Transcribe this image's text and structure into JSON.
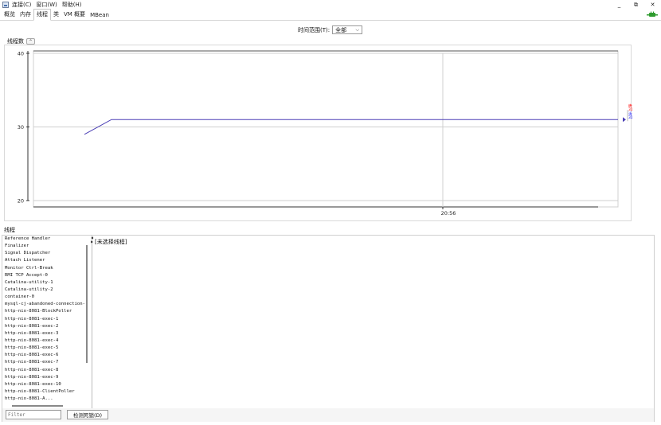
{
  "menu": {
    "items": [
      "连接(C)",
      "窗口(W)",
      "帮助(H)"
    ]
  },
  "window_controls": {
    "minimize": "_",
    "restore": "⧉",
    "close": "✕"
  },
  "tabs": [
    "概览",
    "内存",
    "线程",
    "类",
    "VM 概要",
    "MBean"
  ],
  "active_tab": "线程",
  "time_range": {
    "label": "时间范围(T):",
    "value": "全部"
  },
  "chart_section": {
    "title": "线程数",
    "collapse_icon": "collapse-icon"
  },
  "chart_data": {
    "type": "line",
    "y_ticks": [
      "40",
      "30",
      "20"
    ],
    "ylim": [
      20,
      40
    ],
    "x_tick": "20:56",
    "series": [
      {
        "name": "峰值",
        "value": "31",
        "color": "#ff0000"
      },
      {
        "name": "活动线程",
        "value": "31",
        "color": "#0000ff"
      }
    ],
    "line_values": [
      29,
      31,
      31,
      31
    ],
    "line_color": "#4b3fb5"
  },
  "threads_section": {
    "title": "线程",
    "items": [
      "Reference Handler",
      "Finalizer",
      "Signal Dispatcher",
      "Attach Listener",
      "Monitor Ctrl-Break",
      "RMI TCP Accept-0",
      "Catalina-utility-1",
      "Catalina-utility-2",
      "container-0",
      "mysql-cj-abandoned-connection-",
      "http-nio-8081-BlockPoller",
      "http-nio-8081-exec-1",
      "http-nio-8081-exec-2",
      "http-nio-8081-exec-3",
      "http-nio-8081-exec-4",
      "http-nio-8081-exec-5",
      "http-nio-8081-exec-6",
      "http-nio-8081-exec-7",
      "http-nio-8081-exec-8",
      "http-nio-8081-exec-9",
      "http-nio-8081-exec-10",
      "http-nio-8081-ClientPoller",
      "http-nio-8081-A..."
    ],
    "detail_text": "[未选择线程]",
    "filter_placeholder": "Filter",
    "detect_button": "检测死锁(D)"
  }
}
